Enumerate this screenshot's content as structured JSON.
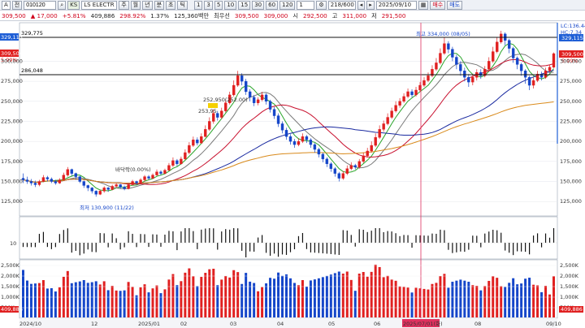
{
  "toolbar": {
    "symbol_prefix": "A",
    "sel_label": "전",
    "code": "010120",
    "market_badge": "KS",
    "stock_name": "LS ELECTR",
    "chart_buttons": [
      "주",
      "월",
      "년",
      "분",
      "초",
      "틱"
    ],
    "interval_buttons": [
      "1",
      "3",
      "5",
      "10",
      "15",
      "30",
      "60",
      "120"
    ],
    "period_value": "1",
    "count_value": "218/600",
    "date_value": "2025/09/10",
    "buy_label": "매수",
    "sell_label": "매도"
  },
  "quote": {
    "current": "309,500",
    "change": "17,000",
    "change_pct": "+5.81%",
    "volume": "409,886",
    "volume_ratio": "298.92%",
    "turnover": "1.37%",
    "amount": "125,360백만",
    "best_ask_label": "최우선",
    "best_ask": "309,500",
    "best_bid": "309,000",
    "open_label": "시",
    "open": "292,500",
    "high_label": "고",
    "high": "311,000",
    "low_label": "저",
    "low": "291,500"
  },
  "chart": {
    "price_ticks": [
      "300,000",
      "275,000",
      "250,000",
      "225,000",
      "200,000",
      "175,000",
      "150,000",
      "125,000"
    ],
    "price_tick_values": [
      300000,
      275000,
      250000,
      225000,
      200000,
      175000,
      150000,
      125000
    ],
    "left_tags": {
      "top_line": "329,775",
      "mid_line": "286,048",
      "box1": "329,115",
      "box2": "309,500",
      "pct": "5.99%"
    },
    "right_tags": {
      "r1": "LC:136.44",
      "r2": "HC:7.34",
      "box1": "329,115",
      "box2": "309,500",
      "pct": "5.99%"
    },
    "annotations": {
      "high": "최고 334,000 (08/05)",
      "low": "최저 130,900 (11/22)",
      "bottom": "바닥락(0.00%)",
      "mid": "252,950(252.00)",
      "mid2": "253,95"
    },
    "osc_ticks": [
      "10"
    ],
    "volume_ticks": [
      "2,500K",
      "2,000K",
      "1,500K",
      "1,000K",
      "500K"
    ],
    "volume_label": "409,886",
    "x_labels": [
      "2024/10",
      "12",
      "2025/01",
      "02",
      "03",
      "04",
      "05",
      "06",
      "2025/07/01(화)",
      "08",
      "09/10"
    ],
    "price_min": 110000,
    "price_max": 345000,
    "candles": [
      [
        154000,
        152000,
        160000,
        148000
      ],
      [
        152000,
        150000,
        156000,
        147000
      ],
      [
        150000,
        148000,
        153000,
        145000
      ],
      [
        148000,
        146000,
        151000,
        143000
      ],
      [
        146000,
        150000,
        152000,
        144000
      ],
      [
        150000,
        155000,
        158000,
        149000
      ],
      [
        155000,
        153000,
        157000,
        150000
      ],
      [
        153000,
        150000,
        155000,
        148000
      ],
      [
        150000,
        148000,
        152000,
        146000
      ],
      [
        148000,
        152000,
        154000,
        147000
      ],
      [
        152000,
        158000,
        161000,
        151000
      ],
      [
        158000,
        165000,
        168000,
        156000
      ],
      [
        165000,
        160000,
        166000,
        157000
      ],
      [
        160000,
        156000,
        161000,
        152000
      ],
      [
        156000,
        150000,
        157000,
        148000
      ],
      [
        150000,
        145000,
        151000,
        142000
      ],
      [
        145000,
        142000,
        146000,
        138000
      ],
      [
        142000,
        138000,
        143000,
        135000
      ],
      [
        138000,
        134000,
        139000,
        131000
      ],
      [
        134000,
        138000,
        140000,
        133000
      ],
      [
        138000,
        142000,
        144000,
        136000
      ],
      [
        142000,
        140000,
        143000,
        137000
      ],
      [
        140000,
        144000,
        146000,
        139000
      ],
      [
        144000,
        146000,
        148000,
        142000
      ],
      [
        146000,
        143000,
        147000,
        141000
      ],
      [
        143000,
        141000,
        145000,
        139000
      ],
      [
        141000,
        146000,
        148000,
        140000
      ],
      [
        146000,
        150000,
        152000,
        145000
      ],
      [
        150000,
        148000,
        151000,
        146000
      ],
      [
        148000,
        152000,
        154000,
        147000
      ],
      [
        152000,
        156000,
        158000,
        150000
      ],
      [
        156000,
        154000,
        158000,
        152000
      ],
      [
        154000,
        158000,
        160000,
        153000
      ],
      [
        158000,
        162000,
        165000,
        157000
      ],
      [
        162000,
        160000,
        164000,
        158000
      ],
      [
        160000,
        164000,
        166000,
        159000
      ],
      [
        164000,
        170000,
        173000,
        163000
      ],
      [
        170000,
        176000,
        180000,
        168000
      ],
      [
        176000,
        172000,
        178000,
        169000
      ],
      [
        172000,
        178000,
        181000,
        171000
      ],
      [
        178000,
        186000,
        190000,
        177000
      ],
      [
        186000,
        195000,
        199000,
        184000
      ],
      [
        195000,
        202000,
        206000,
        193000
      ],
      [
        202000,
        198000,
        205000,
        195000
      ],
      [
        198000,
        206000,
        210000,
        197000
      ],
      [
        206000,
        215000,
        220000,
        205000
      ],
      [
        215000,
        225000,
        230000,
        213000
      ],
      [
        225000,
        235000,
        240000,
        222000
      ],
      [
        235000,
        230000,
        238000,
        226000
      ],
      [
        230000,
        238000,
        242000,
        228000
      ],
      [
        238000,
        248000,
        252000,
        236000
      ],
      [
        248000,
        258000,
        262000,
        246000
      ],
      [
        258000,
        270000,
        276000,
        256000
      ],
      [
        270000,
        282000,
        288000,
        268000
      ],
      [
        282000,
        275000,
        285000,
        270000
      ],
      [
        275000,
        262000,
        278000,
        258000
      ],
      [
        262000,
        255000,
        265000,
        250000
      ],
      [
        255000,
        248000,
        258000,
        244000
      ],
      [
        248000,
        252000,
        255000,
        245000
      ],
      [
        252000,
        258000,
        262000,
        250000
      ],
      [
        258000,
        250000,
        260000,
        246000
      ],
      [
        250000,
        240000,
        252000,
        236000
      ],
      [
        240000,
        232000,
        243000,
        228000
      ],
      [
        232000,
        222000,
        235000,
        218000
      ],
      [
        222000,
        214000,
        225000,
        210000
      ],
      [
        214000,
        206000,
        217000,
        202000
      ],
      [
        206000,
        200000,
        209000,
        196000
      ],
      [
        200000,
        196000,
        203000,
        192000
      ],
      [
        196000,
        200000,
        204000,
        194000
      ],
      [
        200000,
        206000,
        210000,
        198000
      ],
      [
        206000,
        202000,
        208000,
        198000
      ],
      [
        202000,
        196000,
        204000,
        192000
      ],
      [
        196000,
        190000,
        198000,
        186000
      ],
      [
        190000,
        184000,
        192000,
        180000
      ],
      [
        184000,
        178000,
        186000,
        174000
      ],
      [
        178000,
        172000,
        180000,
        168000
      ],
      [
        172000,
        166000,
        174000,
        162000
      ],
      [
        166000,
        160000,
        168000,
        156000
      ],
      [
        160000,
        154000,
        162000,
        150000
      ],
      [
        154000,
        160000,
        163000,
        152000
      ],
      [
        160000,
        166000,
        170000,
        158000
      ],
      [
        166000,
        170000,
        174000,
        164000
      ],
      [
        170000,
        168000,
        172000,
        165000
      ],
      [
        168000,
        175000,
        178000,
        166000
      ],
      [
        175000,
        182000,
        186000,
        173000
      ],
      [
        182000,
        188000,
        192000,
        180000
      ],
      [
        188000,
        195000,
        200000,
        186000
      ],
      [
        195000,
        205000,
        210000,
        193000
      ],
      [
        205000,
        215000,
        220000,
        203000
      ],
      [
        215000,
        222000,
        226000,
        212000
      ],
      [
        222000,
        230000,
        235000,
        220000
      ],
      [
        230000,
        238000,
        242000,
        228000
      ],
      [
        238000,
        245000,
        250000,
        236000
      ],
      [
        245000,
        250000,
        254000,
        242000
      ],
      [
        250000,
        256000,
        260000,
        248000
      ],
      [
        256000,
        262000,
        266000,
        254000
      ],
      [
        262000,
        258000,
        265000,
        255000
      ],
      [
        258000,
        264000,
        268000,
        256000
      ],
      [
        264000,
        270000,
        274000,
        262000
      ],
      [
        270000,
        276000,
        280000,
        268000
      ],
      [
        276000,
        282000,
        286000,
        274000
      ],
      [
        282000,
        290000,
        295000,
        280000
      ],
      [
        290000,
        298000,
        304000,
        288000
      ],
      [
        298000,
        310000,
        316000,
        296000
      ],
      [
        310000,
        322000,
        330000,
        308000
      ],
      [
        322000,
        315000,
        325000,
        310000
      ],
      [
        315000,
        305000,
        318000,
        300000
      ],
      [
        305000,
        296000,
        308000,
        290000
      ],
      [
        296000,
        288000,
        300000,
        282000
      ],
      [
        288000,
        280000,
        292000,
        275000
      ],
      [
        280000,
        274000,
        284000,
        268000
      ],
      [
        274000,
        280000,
        284000,
        270000
      ],
      [
        280000,
        286000,
        290000,
        276000
      ],
      [
        286000,
        282000,
        290000,
        278000
      ],
      [
        282000,
        290000,
        294000,
        280000
      ],
      [
        290000,
        300000,
        305000,
        288000
      ],
      [
        300000,
        312000,
        318000,
        298000
      ],
      [
        312000,
        324000,
        330000,
        310000
      ],
      [
        324000,
        334000,
        338000,
        322000
      ],
      [
        334000,
        326000,
        336000,
        320000
      ],
      [
        326000,
        316000,
        328000,
        310000
      ],
      [
        316000,
        304000,
        318000,
        298000
      ],
      [
        304000,
        296000,
        306000,
        290000
      ],
      [
        296000,
        288000,
        298000,
        282000
      ],
      [
        288000,
        280000,
        290000,
        272000
      ],
      [
        280000,
        270000,
        282000,
        264000
      ],
      [
        270000,
        276000,
        280000,
        266000
      ],
      [
        276000,
        284000,
        288000,
        274000
      ],
      [
        284000,
        280000,
        287000,
        276000
      ],
      [
        280000,
        288000,
        292000,
        278000
      ],
      [
        288000,
        292500,
        296000,
        286000
      ],
      [
        292500,
        309500,
        311000,
        291500
      ]
    ]
  }
}
